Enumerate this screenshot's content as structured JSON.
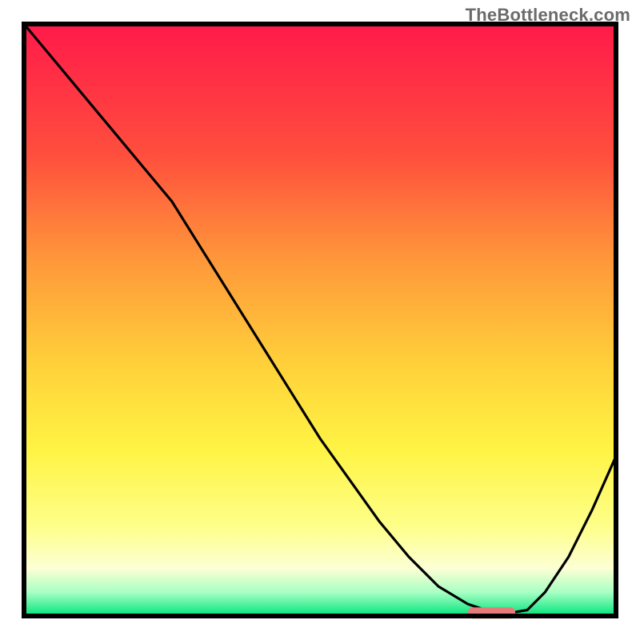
{
  "watermark": "TheBottleneck.com",
  "colors": {
    "top": "#ff1a4a",
    "mid_red": "#ff4e3d",
    "mid_orange": "#ff983a",
    "mid_yellow": "#ffd23a",
    "yellow": "#fff444",
    "pale_yellow": "#feff8a",
    "cream": "#fcffd4",
    "mint": "#a8ffc4",
    "green": "#00e47a",
    "curve": "#000000",
    "marker": "#e77a7a",
    "frame": "#000000",
    "bg": "#ffffff"
  },
  "chart_data": {
    "type": "line",
    "title": "",
    "xlabel": "",
    "ylabel": "",
    "xlim": [
      0,
      100
    ],
    "ylim": [
      0,
      100
    ],
    "x": [
      0,
      5,
      10,
      15,
      20,
      25,
      30,
      35,
      40,
      45,
      50,
      55,
      60,
      65,
      70,
      75,
      78,
      80,
      82,
      85,
      88,
      92,
      96,
      100
    ],
    "values": [
      100,
      94,
      88,
      82,
      76,
      70,
      62,
      54,
      46,
      38,
      30,
      23,
      16,
      10,
      5,
      2,
      1,
      0.5,
      0.5,
      1,
      4,
      10,
      18,
      27
    ],
    "marker": {
      "x_start": 75,
      "x_end": 83,
      "y": 0.5
    }
  }
}
